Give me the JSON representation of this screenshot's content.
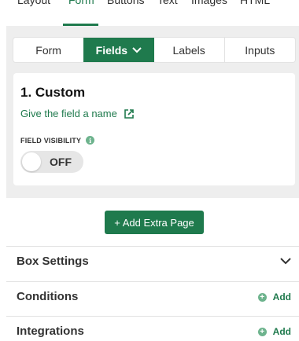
{
  "top_tabs": [
    {
      "label": "Layout"
    },
    {
      "label": "Form"
    },
    {
      "label": "Buttons"
    },
    {
      "label": "Text"
    },
    {
      "label": "Images"
    },
    {
      "label": "HTML"
    }
  ],
  "sub_tabs": [
    {
      "label": "Form"
    },
    {
      "label": "Fields"
    },
    {
      "label": "Labels"
    },
    {
      "label": "Inputs"
    }
  ],
  "field": {
    "title": "1. Custom",
    "link": "Give the field a name",
    "visibility_label": "FIELD VISIBILITY",
    "visibility_info": "i",
    "toggle_state": "OFF"
  },
  "add_page_label": "+ Add Extra Page",
  "sections": {
    "box_settings": {
      "title": "Box Settings"
    },
    "conditions": {
      "title": "Conditions",
      "action": "Add"
    },
    "integrations": {
      "title": "Integrations",
      "action": "Add"
    }
  },
  "colors": {
    "accent": "#1f7a4d",
    "panel": "#eeeeee"
  }
}
